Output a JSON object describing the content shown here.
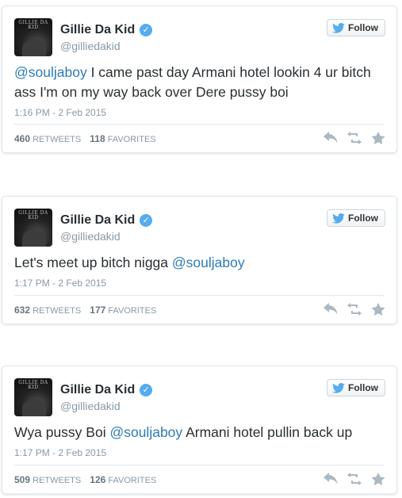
{
  "follow_label": "Follow",
  "tweets": [
    {
      "name": "Gillie Da Kid",
      "handle": "@gilliedakid",
      "avatar_text": "GILLIE DA KID",
      "text_mention": "@souljaboy",
      "text_rest": " I came past day Armani hotel lookin 4 ur bitch ass I'm on my way back over Dere pussy boi",
      "timestamp": "1:16 PM - 2 Feb 2015",
      "retweets": "460",
      "retweets_label": "RETWEETS",
      "favorites": "118",
      "favorites_label": "FAVORITES"
    },
    {
      "name": "Gillie Da Kid",
      "handle": "@gilliedakid",
      "avatar_text": "GILLIE DA KID",
      "text_before": "Let's meet up bitch nigga ",
      "text_mention": "@souljaboy",
      "timestamp": "1:17 PM - 2 Feb 2015",
      "retweets": "632",
      "retweets_label": "RETWEETS",
      "favorites": "177",
      "favorites_label": "FAVORITES"
    },
    {
      "name": "Gillie Da Kid",
      "handle": "@gilliedakid",
      "avatar_text": "GILLIE DA KID",
      "text_before": "Wya pussy Boi ",
      "text_mention": "@souljaboy",
      "text_rest": " Armani hotel pullin back up",
      "timestamp": "1:17 PM - 2 Feb 2015",
      "retweets": "509",
      "retweets_label": "RETWEETS",
      "favorites": "126",
      "favorites_label": "FAVORITES"
    }
  ],
  "colors": {
    "mention": "#2b7bb9",
    "verified": "#55acee",
    "twitter_bird": "#55acee",
    "meta_gray": "#8899a6"
  },
  "icons": [
    "verified-badge-icon",
    "twitter-bird-icon",
    "reply-icon",
    "retweet-icon",
    "favorite-star-icon"
  ]
}
